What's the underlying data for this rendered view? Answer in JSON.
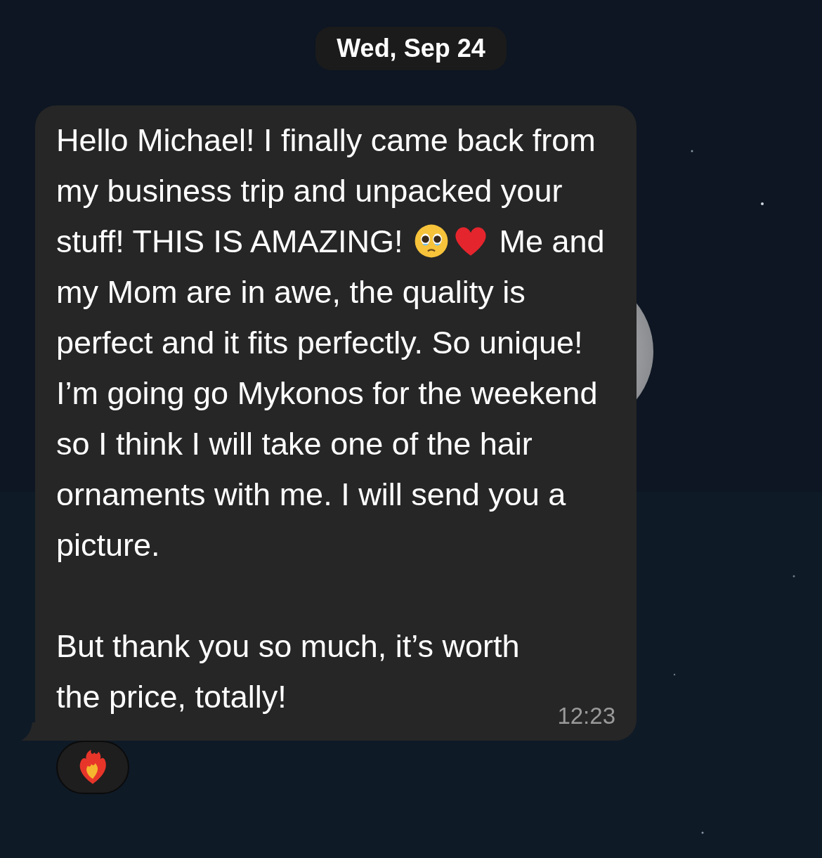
{
  "date_label": "Wed, Sep 24",
  "message": {
    "paragraphs": [
      [
        {
          "kind": "text",
          "text": "Hello Michael! I finally came back from my business trip and unpacked your stuff! THIS IS AMAZING! "
        },
        {
          "kind": "face"
        },
        {
          "kind": "heart"
        },
        {
          "kind": "text",
          "text": " Me and my Mom are in awe, the quality is perfect and it fits perfectly. So unique! I’m going go Mykonos for the weekend so I think I will take one of the hair ornaments with me. I will send you a picture."
        }
      ],
      [
        {
          "kind": "text",
          "text": "But thank you so much, it’s worth the price, totally!"
        }
      ]
    ],
    "time": "12:23",
    "reaction": {
      "kind": "fireheart"
    }
  }
}
